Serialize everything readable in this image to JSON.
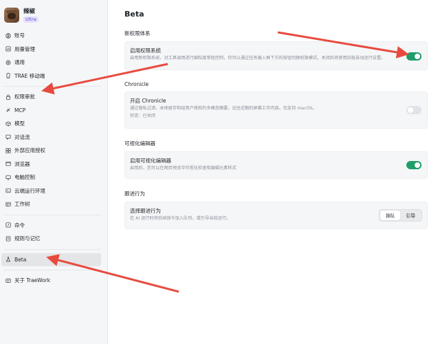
{
  "sidebar": {
    "profile": {
      "name": "辣椒",
      "plan": "Ultra"
    },
    "items": [
      {
        "label": "账号",
        "icon": "account-icon"
      },
      {
        "label": "用量管理",
        "icon": "usage-icon"
      },
      {
        "label": "通用",
        "icon": "gear-icon"
      },
      {
        "label": "TRAE 移动端",
        "icon": "mobile-icon"
      },
      {
        "label": "权限审批",
        "icon": "lock-icon"
      },
      {
        "label": "MCP",
        "icon": "mcp-icon"
      },
      {
        "label": "模型",
        "icon": "cube-icon"
      },
      {
        "label": "对话流",
        "icon": "chat-icon"
      },
      {
        "label": "外部应用授权",
        "icon": "app-auth-icon"
      },
      {
        "label": "浏览器",
        "icon": "browser-icon"
      },
      {
        "label": "电脑控制",
        "icon": "computer-icon"
      },
      {
        "label": "云端运行环境",
        "icon": "cloud-icon"
      },
      {
        "label": "工作树",
        "icon": "worktree-icon"
      }
    ],
    "items2": [
      {
        "label": "命令",
        "icon": "command-icon"
      },
      {
        "label": "规则与记忆",
        "icon": "rules-icon"
      }
    ],
    "items3": [
      {
        "label": "Beta",
        "icon": "beta-flask-icon"
      }
    ],
    "items4": [
      {
        "label": "关于 TraeWork",
        "icon": "about-icon"
      }
    ]
  },
  "main": {
    "title": "Beta",
    "sections": [
      {
        "title": "新权限体系",
        "card": {
          "title": "启用权限系统",
          "desc": "启用新权限系统，对工具调用进行细粒度审批控制，你可以通过任务输入框下方的按钮切换权限模式。关闭后将使用旧版自动运行设置。",
          "toggle": true
        }
      },
      {
        "title": "Chronicle",
        "card": {
          "title": "开启 Chronicle",
          "desc": "通过隐私过滤、本地留存和经用户授权的多模态摘要，记住近期的屏幕工作内容。仅支持 macOS。",
          "status": "状态：已关闭",
          "toggle": false
        }
      },
      {
        "title": "可视化编辑器",
        "card": {
          "title": "启用可视化编辑器",
          "desc": "启用后，您可以在网页预览中可视化检查和编辑元素样式",
          "toggle": true
        }
      },
      {
        "title": "跟进行为",
        "card": {
          "title": "选择跟进行为",
          "desc": "在 AI 运行时将后续指令加入队列，或引导当前运行。",
          "options": [
            "排队",
            "引导"
          ],
          "selected": "排队"
        }
      }
    ]
  },
  "colors": {
    "toggle_on": "#1f9e6a",
    "toggle_off": "#e1e3e6",
    "arrow": "#e84a3f",
    "badge": "#5b4bd6"
  }
}
